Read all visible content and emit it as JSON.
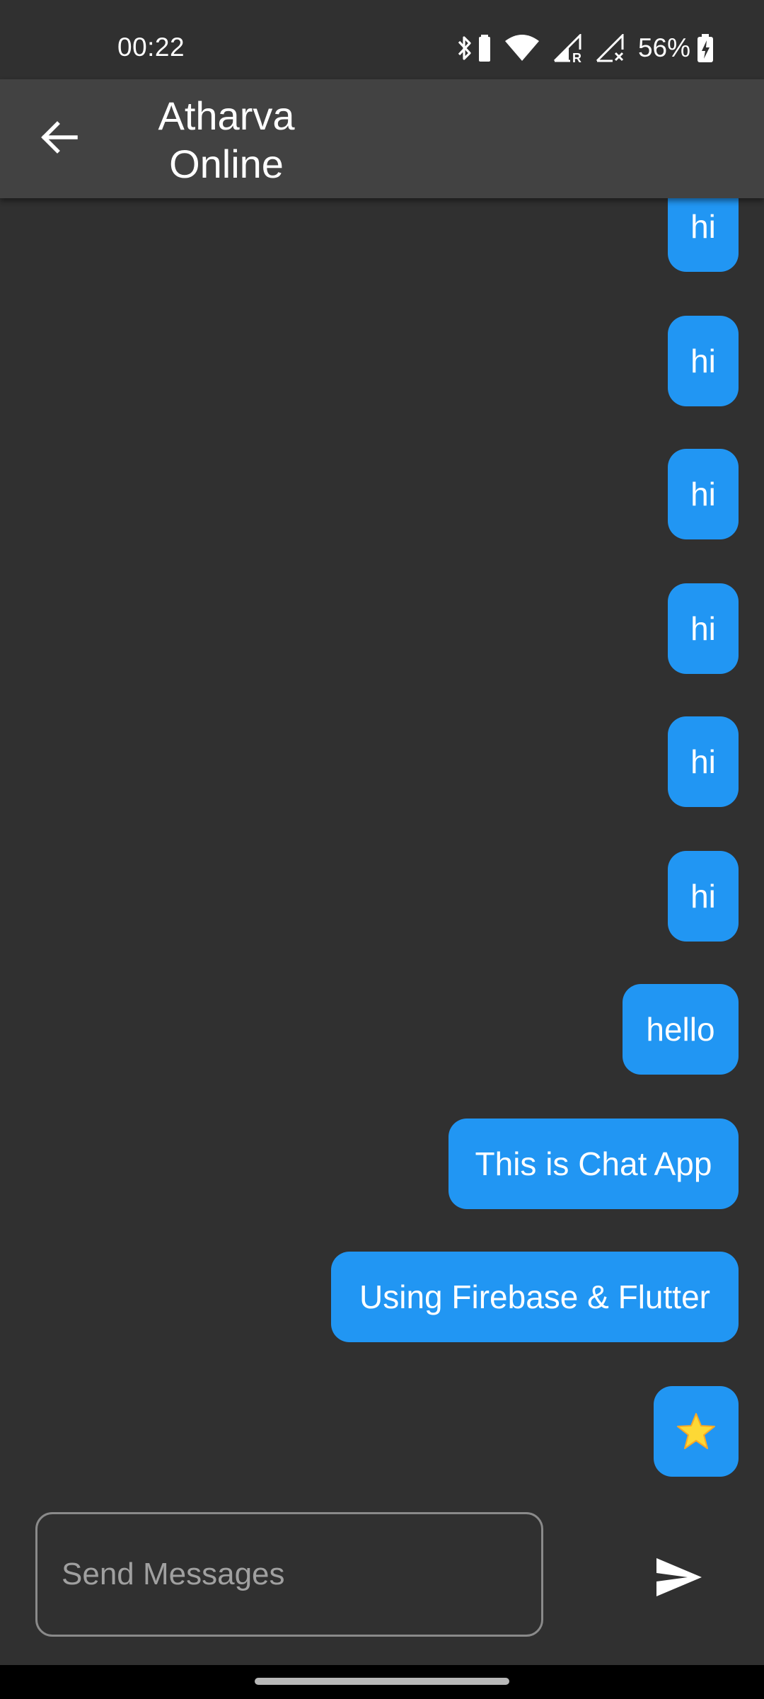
{
  "status_bar": {
    "time": "00:22",
    "battery_percent": "56%",
    "icons": [
      "bluetooth-icon",
      "battery-saver-icon",
      "wifi-icon",
      "signal-roaming-icon",
      "signal-no-service-icon",
      "battery-charging-icon"
    ]
  },
  "app_bar": {
    "back_icon": "arrow-left-icon",
    "title": "Atharva Online"
  },
  "messages": [
    {
      "text": "hi"
    },
    {
      "text": "hi"
    },
    {
      "text": "hi"
    },
    {
      "text": "hi"
    },
    {
      "text": "hi"
    },
    {
      "text": "hi"
    },
    {
      "text": "hello"
    },
    {
      "text": "This is Chat App"
    },
    {
      "text": "Using Firebase & Flutter"
    },
    {
      "text": "⭐"
    }
  ],
  "composer": {
    "placeholder": "Send Messages",
    "value": "",
    "send_icon": "send-icon"
  },
  "colors": {
    "background": "#303030",
    "app_bar": "#424242",
    "bubble": "#2196f3",
    "text": "#ffffff"
  }
}
